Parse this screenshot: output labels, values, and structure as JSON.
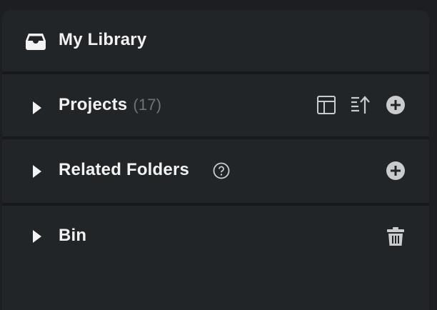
{
  "library": {
    "title": "My Library",
    "icon": "inbox-tray-icon"
  },
  "sections": {
    "projects": {
      "label": "Projects",
      "count": "(17)",
      "actions": [
        "layout-icon",
        "sort-icon",
        "add-circle-icon"
      ]
    },
    "related_folders": {
      "label": "Related Folders",
      "actions": [
        "help-circle-icon",
        "add-circle-icon"
      ]
    },
    "bin": {
      "label": "Bin",
      "actions": [
        "trash-icon"
      ]
    }
  },
  "colors": {
    "panel_bg": "#222528",
    "divider": "#17191b",
    "text": "#f2f2f2",
    "muted": "#6f7377",
    "icon": "#c9cbcd"
  }
}
